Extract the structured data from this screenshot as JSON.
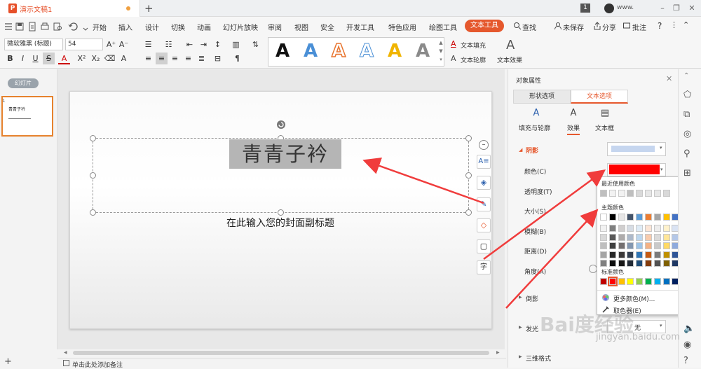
{
  "titlebar": {
    "doc_name": "演示文稿1",
    "new_tab": "+",
    "page_count": "1",
    "user": "www.",
    "min": "–",
    "restore": "❐",
    "close": "✕"
  },
  "menubar": {
    "items": [
      "开始",
      "插入",
      "设计",
      "切换",
      "动画",
      "幻灯片放映",
      "审阅",
      "视图",
      "安全",
      "开发工具",
      "特色应用",
      "绘图工具"
    ],
    "active": "文本工具",
    "search": "查找",
    "save_status": "未保存",
    "share": "分享",
    "annotate": "批注",
    "help": "?"
  },
  "ribbon": {
    "font_name": "微软雅黑 (标题)",
    "font_size": "54",
    "bold": "B",
    "italic": "I",
    "underline": "U",
    "strike": "S",
    "text_fill": "文本填充",
    "text_outline": "文本轮廓",
    "text_effect": "文本效果",
    "gallery_letter": "A",
    "gallery_colors": [
      "#111111",
      "#4a8fd6",
      "#e8742e",
      "#4a8fd6",
      "#f0b400",
      "#8a8a8a"
    ]
  },
  "left": {
    "slides_tab": "幻灯片",
    "thumb_num": "1",
    "thumb_title": "青青子衿"
  },
  "slide": {
    "title": "青青子衿",
    "subtitle": "在此输入您的封面副标题"
  },
  "notes": {
    "placeholder": "单击此处添加备注"
  },
  "panel": {
    "title": "对象属性",
    "tab_shape": "形状选项",
    "tab_text": "文本选项",
    "subtabs": [
      {
        "icon": "A",
        "label": "填充与轮廓"
      },
      {
        "icon": "A",
        "label": "效果"
      },
      {
        "icon": "▤",
        "label": "文本框"
      }
    ],
    "shadow": "阴影",
    "color": "颜色(C)",
    "transparency": "透明度(T)",
    "size": "大小(S)",
    "blur": "模糊(B)",
    "distance": "距离(D)",
    "angle": "角度(A)",
    "reflection": "倒影",
    "glow": "发光",
    "glow_value": "无",
    "three_d": "三维格式",
    "shadow_color": "#c6d6ef",
    "current_color": "#ff0000"
  },
  "palette": {
    "recent_label": "最近使用颜色",
    "theme_label": "主题颜色",
    "standard_label": "标准颜色",
    "more": "更多颜色(M)...",
    "picker": "取色器(E)",
    "recent": [
      "#bfbfbf",
      "#f2f2f2",
      "#f2f2f2",
      "#bfbfbf",
      "#d9d9d9",
      "#e7e7e7",
      "#e7e7e7",
      "#d9d9d9"
    ],
    "theme_top": [
      "#ffffff",
      "#000000",
      "#e7e6e6",
      "#44546a",
      "#5b9bd5",
      "#ed7d31",
      "#a5a5a5",
      "#ffc000",
      "#4472c4",
      "#70ad47"
    ],
    "theme_shades": [
      [
        "#f2f2f2",
        "#7f7f7f",
        "#d0cece",
        "#d6dce4",
        "#deebf6",
        "#fbe5d6",
        "#ededed",
        "#fff2cc",
        "#dae3f3",
        "#e2f0d9"
      ],
      [
        "#d9d9d9",
        "#595959",
        "#aeabab",
        "#adb9ca",
        "#bdd7ee",
        "#f8cbad",
        "#dbdbdb",
        "#ffe699",
        "#b4c7e7",
        "#c5e0b4"
      ],
      [
        "#bfbfbf",
        "#3f3f3f",
        "#757070",
        "#8497b0",
        "#9dc3e6",
        "#f4b183",
        "#c9c9c9",
        "#ffd966",
        "#8faadc",
        "#a9d18e"
      ],
      [
        "#a5a5a5",
        "#262626",
        "#3a3838",
        "#333f50",
        "#2e75b6",
        "#c55a11",
        "#7b7b7b",
        "#bf9000",
        "#2f5597",
        "#538135"
      ],
      [
        "#7f7f7f",
        "#0d0d0d",
        "#171616",
        "#222a35",
        "#1f4e79",
        "#843c0c",
        "#525252",
        "#7f6000",
        "#1f3864",
        "#375623"
      ]
    ],
    "standard": [
      "#c00000",
      "#ff0000",
      "#ffc000",
      "#ffff00",
      "#92d050",
      "#00b050",
      "#00b0f0",
      "#0070c0",
      "#002060",
      "#7030a0"
    ]
  },
  "watermark": {
    "main": "Bai度经验",
    "sub": "jingyan.baidu.com"
  }
}
